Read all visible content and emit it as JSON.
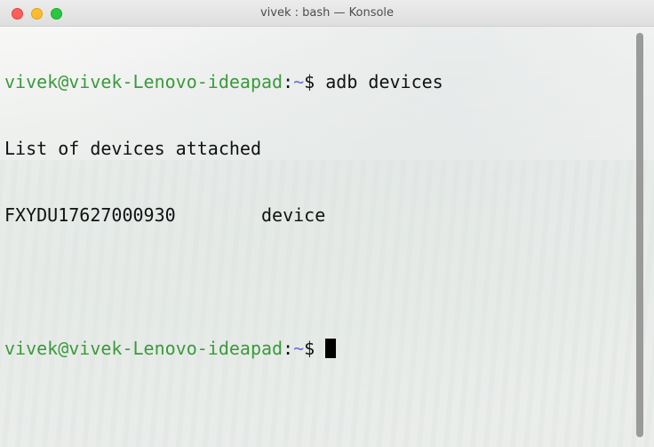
{
  "window": {
    "title": "vivek : bash — Konsole"
  },
  "terminal": {
    "lines": [
      {
        "user_host": "vivek@vivek-Lenovo-ideapad",
        "separator": ":",
        "dir": "~",
        "prompt_symbol": "$ ",
        "command": "adb devices"
      },
      {
        "text": "List of devices attached"
      },
      {
        "text": "FXYDU17627000930        device"
      },
      {
        "text": ""
      },
      {
        "user_host": "vivek@vivek-Lenovo-ideapad",
        "separator": ":",
        "dir": "~",
        "prompt_symbol": "$ ",
        "command": ""
      }
    ]
  },
  "colors": {
    "user_host": "#3b9a3b",
    "dir": "#6b6bd6",
    "text": "#111111",
    "close": "#ff5f57",
    "minimize": "#febc2e",
    "maximize": "#28c840"
  }
}
